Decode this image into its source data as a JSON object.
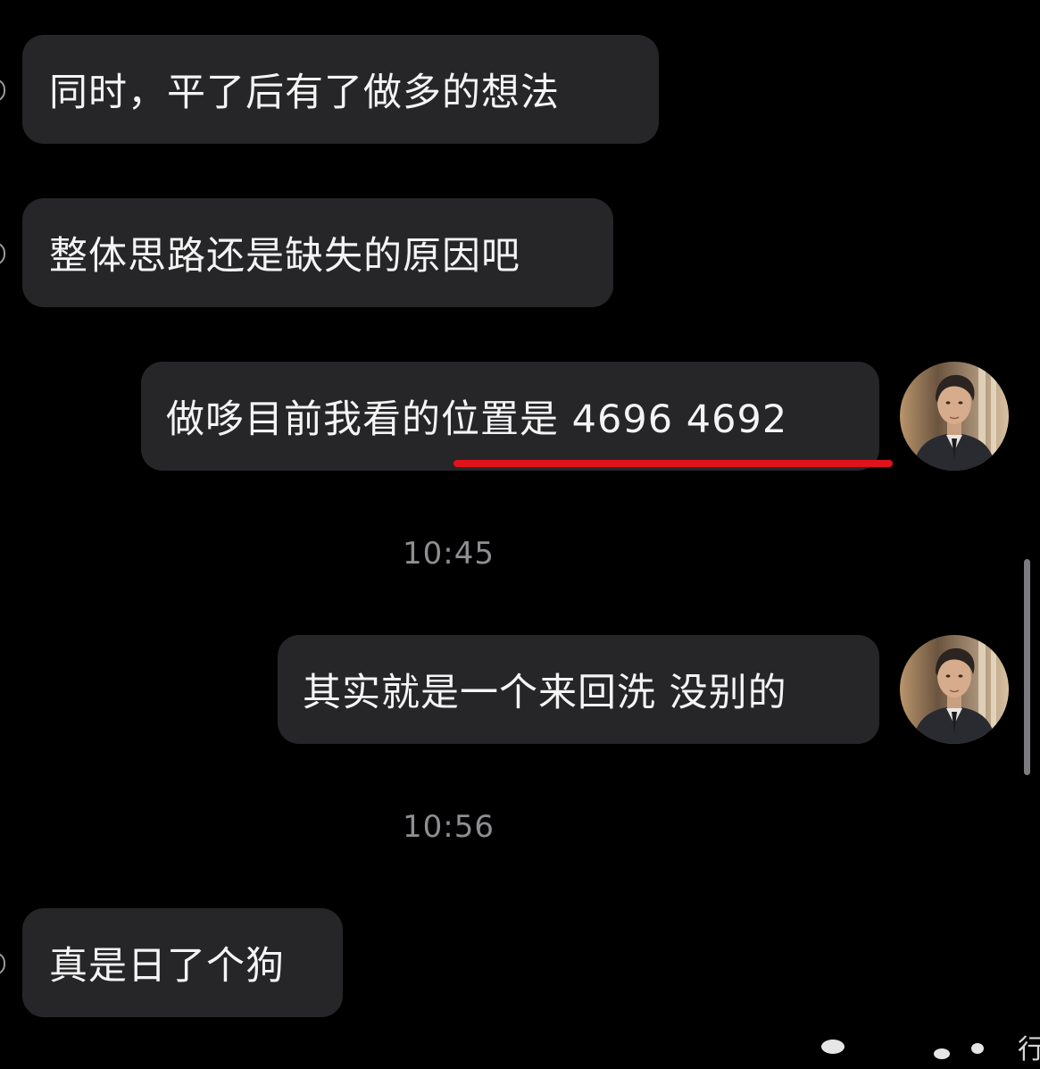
{
  "messages": [
    {
      "side": "incoming",
      "text": "同时，平了后有了做多的想法"
    },
    {
      "side": "incoming",
      "text": "整体思路还是缺失的原因吧"
    },
    {
      "side": "outgoing",
      "text": "做哆目前我看的位置是 4696 4692",
      "highlighted": true
    },
    {
      "side": "outgoing",
      "text": "其实就是一个来回洗 没别的"
    },
    {
      "side": "incoming",
      "text": "真是日了个狗"
    }
  ],
  "timestamps": [
    "10:45",
    "10:56"
  ],
  "partial_edge_text": "行",
  "colors": {
    "background": "#000000",
    "bubble": "#262628",
    "text": "#f4f4f4",
    "timestamp": "#8e8e93",
    "highlight_underline": "#e0121b"
  },
  "icons": {
    "self_avatar": "portrait-avatar-icon",
    "contact_avatar": "partial-avatar-icon"
  }
}
